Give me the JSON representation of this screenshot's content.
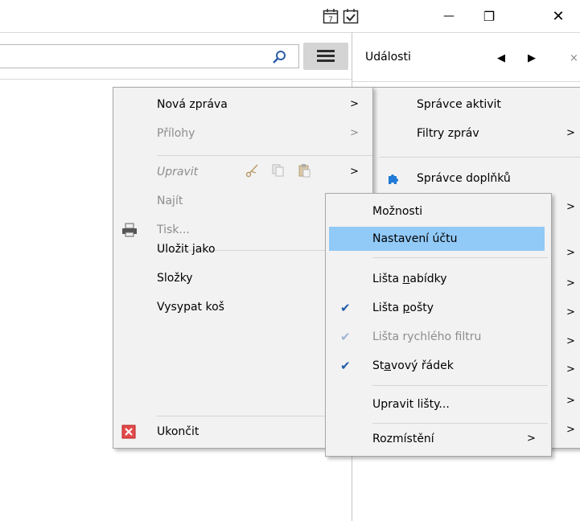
{
  "titlebar": {
    "icons": [
      "calendar-icon",
      "tasks-icon"
    ],
    "minimize": "—",
    "restore": "❐",
    "close": "✕"
  },
  "toolbar": {
    "search_icon": "search-icon",
    "menu_icon": "hamburger-menu-icon"
  },
  "events_panel": {
    "title": "Události",
    "prev": "◀",
    "next": "▶",
    "close": "×"
  },
  "app_menu": {
    "items": [
      {
        "label": "Nová zpráva",
        "arrow": ">",
        "enabled": true
      },
      {
        "label": "Přílohy",
        "arrow": ">",
        "enabled": false
      },
      {
        "label": "Upravit",
        "arrow": ">",
        "enabled": false
      },
      {
        "label": "Najít",
        "arrow": ">",
        "enabled": false
      },
      {
        "label": "Tisk...",
        "enabled": false
      },
      {
        "label": "Uložit jako",
        "arrow": ">",
        "enabled": true
      },
      {
        "label": "Složky",
        "arrow": ">",
        "enabled": true
      },
      {
        "label": "Vysypat koš",
        "arrow": ">",
        "enabled": true
      },
      {
        "label": "Ukončit",
        "enabled": true
      }
    ]
  },
  "right_menu": {
    "items": [
      {
        "label": "Správce aktivit"
      },
      {
        "label": "Filtry zpráv",
        "arrow": ">"
      },
      {
        "label": "Správce doplňků"
      },
      {
        "arrow": ">"
      },
      {
        "arrow": ">"
      },
      {
        "arrow": ">"
      },
      {
        "arrow": ">"
      },
      {
        "arrow": ">"
      },
      {
        "arrow": ">"
      },
      {
        "arrow": ">"
      },
      {
        "arrow": ">"
      }
    ]
  },
  "options_submenu": {
    "items": [
      {
        "label": "Možnosti"
      },
      {
        "label": "Nastavení účtu",
        "highlighted": true
      },
      {
        "label_pre": "Lišta ",
        "label_u": "n",
        "label_post": "abídky",
        "checked": false
      },
      {
        "label_pre": "Lišta ",
        "label_u": "p",
        "label_post": "ošty",
        "checked": true
      },
      {
        "label": "Lišta rychlého filtru",
        "checked": true,
        "enabled": false
      },
      {
        "label_pre": "St",
        "label_u": "a",
        "label_post": "vový řádek",
        "checked": true
      },
      {
        "label": "Upravit lišty..."
      },
      {
        "label": "Rozmístění",
        "arrow": ">"
      }
    ],
    "checkmark": "✔"
  },
  "colors": {
    "highlight": "#91c9f7",
    "menu_bg": "#f2f2f2",
    "disabled_text": "#8d8d8d"
  }
}
